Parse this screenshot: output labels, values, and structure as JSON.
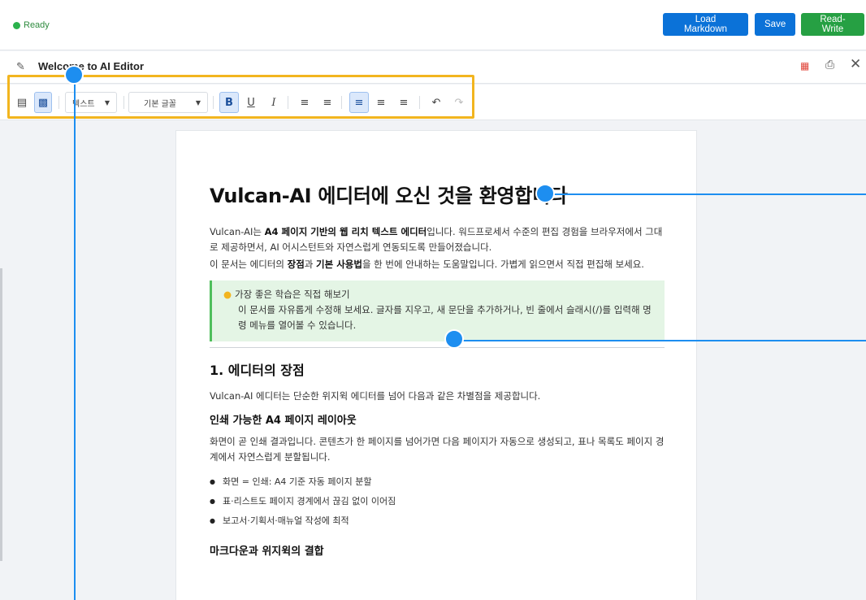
{
  "status": {
    "text": "Ready"
  },
  "top_buttons": {
    "load": "Load Markdown",
    "save": "Save",
    "readwrite": "Read-Write"
  },
  "doc_header": {
    "title": "Welcome to AI Editor"
  },
  "toolbar": {
    "style_dropdown": "텍스트",
    "font_dropdown": "기본 글꼴",
    "bold": "B",
    "underline": "U",
    "italic": "I"
  },
  "document": {
    "h1": "Vulcan-AI 에디터에 오신 것을 환영합니다",
    "intro1_a": "Vulcan-AI는 ",
    "intro1_b": "A4 페이지 기반의 웹 리치 텍스트 에디터",
    "intro1_c": "입니다. 워드프로세서 수준의 편집 경험을 브라우저에서 그대로 제공하면서, AI 어시스턴트와 자연스럽게 연동되도록 만들어졌습니다.",
    "intro2_a": "이 문서는 에디터의 ",
    "intro2_b": "장점",
    "intro2_c": "과 ",
    "intro2_d": "기본 사용법",
    "intro2_e": "을 한 번에 안내하는 도움말입니다. 가볍게 읽으면서 직접 편집해 보세요.",
    "callout_title": "가장 좋은 학습은 직접 해보기",
    "callout_body": "이 문서를 자유롭게 수정해 보세요. 글자를 지우고, 새 문단을 추가하거나, 빈 줄에서 슬래시(/)를 입력해 명령 메뉴를 열어볼 수 있습니다.",
    "h2": "1. 에디터의 장점",
    "p_h2": "Vulcan-AI 에디터는 단순한 위지윅 에디터를 넘어 다음과 같은 차별점을 제공합니다.",
    "h3_1": "인쇄 가능한 A4 페이지 레이아웃",
    "p_h3_1": "화면이 곧 인쇄 결과입니다. 콘텐츠가 한 페이지를 넘어가면 다음 페이지가 자동으로 생성되고, 표나 목록도 페이지 경계에서 자연스럽게 분할됩니다.",
    "bullets": [
      "화면 = 인쇄: A4 기준 자동 페이지 분할",
      "표·리스트도 페이지 경계에서 끊김 없이 이어짐",
      "보고서·기획서·매뉴얼 작성에 최적"
    ],
    "h3_2": "마크다운과 위지윅의 결합"
  },
  "colors": {
    "accent": "#0b72d8",
    "success": "#26a043",
    "highlight": "#f2b51f",
    "marker": "#1d8ef0"
  }
}
